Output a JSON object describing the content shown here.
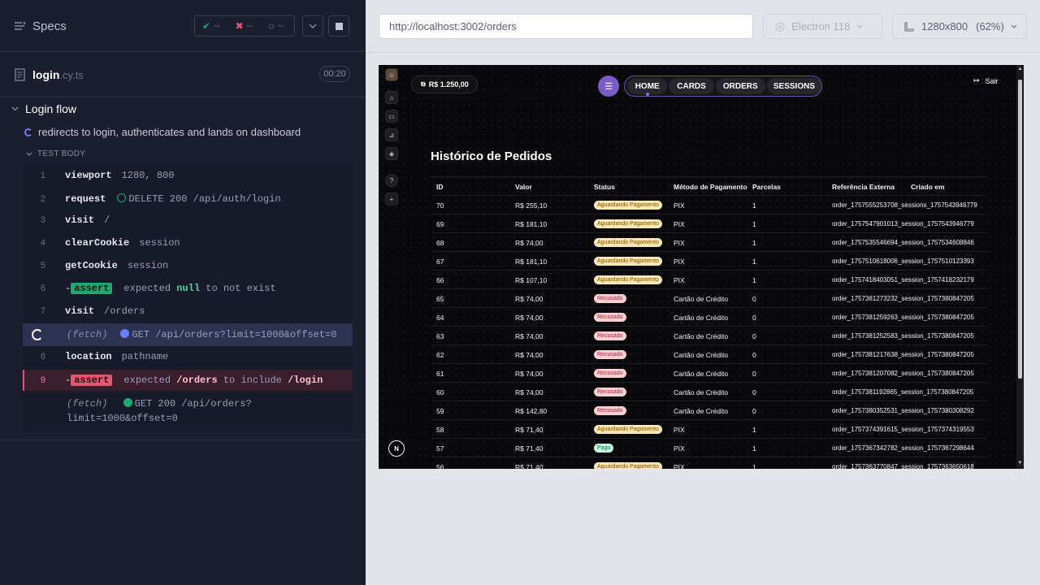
{
  "runner": {
    "specs_label": "Specs",
    "stats": {
      "passed": "--",
      "failed": "--",
      "pending": "--"
    },
    "file": {
      "name": "login",
      "ext": ".cy.ts",
      "timer": "00:20"
    },
    "suite": "Login flow",
    "test": "redirects to login, authenticates and lands on dashboard",
    "body_label": "TEST BODY",
    "commands": [
      {
        "num": "1",
        "name": "viewport",
        "msg": "1280, 800"
      },
      {
        "num": "2",
        "name": "request",
        "msg": "DELETE 200 /api/auth/login"
      },
      {
        "num": "3",
        "name": "visit",
        "msg": "/"
      },
      {
        "num": "4",
        "name": "clearCookie",
        "msg": "session"
      },
      {
        "num": "5",
        "name": "getCookie",
        "msg": "session"
      },
      {
        "num": "6",
        "prefix": "-",
        "chip": "assert",
        "pre": "expected",
        "val1": "null",
        "mid": "to not exist"
      },
      {
        "num": "7",
        "name": "visit",
        "msg": "/orders"
      },
      {
        "label": "(fetch)",
        "msg": "GET /api/orders?limit=1000&offset=0"
      },
      {
        "num": "8",
        "name": "location",
        "msg": "pathname"
      },
      {
        "num": "9",
        "prefix": "-",
        "chip": "assert",
        "pre": "expected",
        "val1": "/orders",
        "mid": "to include",
        "val2": "/login"
      },
      {
        "label": "(fetch)",
        "msg": "GET 200 /api/orders?",
        "msg2": "limit=1000&offset=0"
      }
    ]
  },
  "browser": {
    "url": "http://localhost:3002/orders",
    "engine": "Electron 118",
    "viewport": "1280x800",
    "scale": "(62%)"
  },
  "app": {
    "balance": "R$ 1.250,00",
    "nav": [
      "HOME",
      "CARDS",
      "ORDERS",
      "SESSIONS"
    ],
    "logout": "Sair",
    "title": "Histórico de Pedidos",
    "columns": [
      "ID",
      "Valor",
      "Status",
      "Método de Pagamento",
      "Parcelas",
      "Referência Externa",
      "Criado em"
    ],
    "rows": [
      [
        "70",
        "R$ 255,10",
        "Aguardando Pagamento",
        "PIX",
        "1",
        "order_1757555253708_sessions_1757543946779",
        "wait"
      ],
      [
        "69",
        "R$ 181,10",
        "Aguardando Pagamento",
        "PIX",
        "1",
        "order_1757547901013_session_1757543946779",
        "wait"
      ],
      [
        "68",
        "R$ 74,00",
        "Aguardando Pagamento",
        "PIX",
        "1",
        "order_1757535546694_session_1757534608846",
        "wait"
      ],
      [
        "67",
        "R$ 181,10",
        "Aguardando Pagamento",
        "PIX",
        "1",
        "order_1757510618006_session_1757510123393",
        "wait"
      ],
      [
        "66",
        "R$ 107,10",
        "Aguardando Pagamento",
        "PIX",
        "1",
        "order_1757418403051_session_1757418232179",
        "wait"
      ],
      [
        "65",
        "R$ 74,00",
        "Recusado",
        "Cartão de Crédito",
        "0",
        "order_1757381273232_session_1757380847205",
        "rej"
      ],
      [
        "64",
        "R$ 74,00",
        "Recusado",
        "Cartão de Crédito",
        "0",
        "order_1757381259263_session_1757380847205",
        "rej"
      ],
      [
        "63",
        "R$ 74,00",
        "Recusado",
        "Cartão de Crédito",
        "0",
        "order_1757381252583_session_1757380847205",
        "rej"
      ],
      [
        "62",
        "R$ 74,00",
        "Recusado",
        "Cartão de Crédito",
        "0",
        "order_1757381217638_session_1757380847205",
        "rej"
      ],
      [
        "61",
        "R$ 74,00",
        "Recusado",
        "Cartão de Crédito",
        "0",
        "order_1757381207082_session_1757380847205",
        "rej"
      ],
      [
        "60",
        "R$ 74,00",
        "Recusado",
        "Cartão de Crédito",
        "0",
        "order_1757381192865_session_1757380847205",
        "rej"
      ],
      [
        "59",
        "R$ 142,80",
        "Recusado",
        "Cartão de Crédito",
        "0",
        "order_1757380352531_session_1757380308292",
        "rej"
      ],
      [
        "58",
        "R$ 71,40",
        "Aguardando Pagamento",
        "PIX",
        "1",
        "order_1757374391615_session_1757374319553",
        "wait"
      ],
      [
        "57",
        "R$ 71,40",
        "Pago",
        "PIX",
        "1",
        "order_1757367342782_session_1757367298644",
        "paid"
      ],
      [
        "56",
        "R$ 71,40",
        "Aguardando Pagamento",
        "PIX",
        "1",
        "order_1757363770847_session_1757363650618",
        "wait"
      ]
    ],
    "avatar_letter": "N"
  },
  "icons": {
    "specs": "list-icon",
    "pass": "check-icon",
    "fail": "x-icon",
    "pending": "spinner-icon",
    "chevron": "chevron-down-icon",
    "stop": "stop-icon",
    "file": "file-icon",
    "browser": "chrome-icon",
    "viewport": "ruler-icon",
    "logout": "logout-icon"
  },
  "colors": {
    "pass": "#1fa971",
    "fail": "#e45770",
    "accent": "#7b5cc7",
    "pending": "#6b7dff"
  }
}
